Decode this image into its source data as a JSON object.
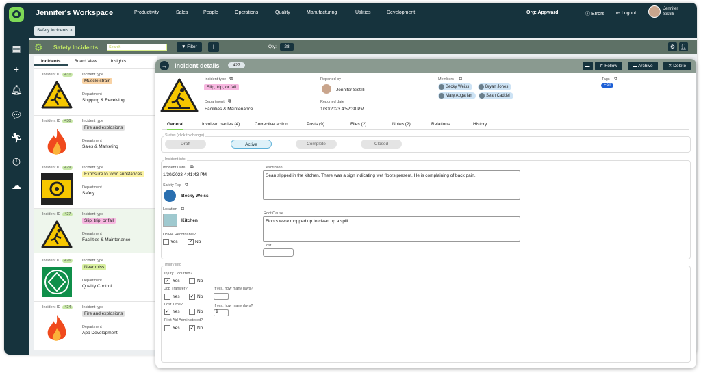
{
  "app": {
    "workspace": "Jennifer's Workspace",
    "menu": [
      "Productivity",
      "Sales",
      "People",
      "Operations",
      "Quality",
      "Manufacturing",
      "Utilities",
      "Development"
    ],
    "org_label": "Org:",
    "org_value": "Appward",
    "errors": "Errors",
    "logout": "Logout",
    "user_first": "Jennifer",
    "user_last": "Sistilli"
  },
  "tab_chip": "Safety Incidents ×",
  "module": {
    "title": "Safety Incidents",
    "search_placeholder": "Search",
    "filter": "Filter",
    "qty_label": "Qty:",
    "qty_value": "28"
  },
  "list": {
    "tabs": [
      "Incidents",
      "Board View",
      "Insights"
    ],
    "id_label": "Incident ID",
    "type_label": "Incident type",
    "dept_label": "Department",
    "items": [
      {
        "id": "431",
        "type": "Muscle strain",
        "type_color": "#f8d2a4",
        "dept": "Shipping & Receiving",
        "icon": "slip"
      },
      {
        "id": "430",
        "type": "Fire and explosions",
        "type_color": "#e0e0e0",
        "dept": "Sales & Marketing",
        "icon": "fire"
      },
      {
        "id": "429",
        "type": "Exposure to toxic substances",
        "type_color": "#fbf3a4",
        "dept": "Safety",
        "icon": "biohazard"
      },
      {
        "id": "427",
        "type": "Slip, trip, or fall",
        "type_color": "#f7b7e0",
        "dept": "Facilities & Maintenance",
        "icon": "slip"
      },
      {
        "id": "426",
        "type": "Near miss",
        "type_color": "#d8efa0",
        "dept": "Quality Control",
        "icon": "safety"
      },
      {
        "id": "424",
        "type": "Fire and explosions",
        "type_color": "#e0e0e0",
        "dept": "App Development",
        "icon": "fire"
      }
    ]
  },
  "detail": {
    "title": "Incident details",
    "number": "427",
    "follow": "Follow",
    "archive": "Archive",
    "delete": "Delete",
    "incident_type_label": "Incident type",
    "incident_type": "Slip, trip, or fall",
    "department_label": "Department",
    "department": "Facilities & Maintenance",
    "reported_by_label": "Reported by",
    "reported_by": "Jennifer Sistilli",
    "reported_date_label": "Reported date",
    "reported_date": "1/30/2023 4:52:38 PM",
    "members_label": "Members",
    "members": [
      "Becky Weiss",
      "Bryan Jones",
      "Mary Abgarian",
      "Sean Caddel"
    ],
    "tags_label": "Tags",
    "tag": "Fall",
    "tabs": [
      "General",
      "Involved parties (4)",
      "Corrective action",
      "Posts (9)",
      "Files (2)",
      "Notes (2)",
      "Relations",
      "History"
    ],
    "status_label": "Status (click to change)",
    "status_steps": [
      "Draft",
      "Active",
      "Complete",
      "Closed"
    ],
    "info_label": "Incident info",
    "date_label": "Incident Date",
    "date": "1/30/2023 4:41:43 PM",
    "rep_label": "Safety Rep",
    "rep": "Becky Weiss",
    "loc_label": "Location",
    "loc": "Kitchen",
    "osha_label": "OSHA Recordable?",
    "yes": "Yes",
    "no": "No",
    "desc_label": "Description",
    "desc": "Sean slipped in the kitchen. There was a sign indicating wet floors present. He is complaining of back pain.",
    "root_label": "Root Cause",
    "root": "Floors were mopped up to clean up a spill.",
    "cost_label": "Cost",
    "injury_label": "Injury info",
    "injury_q": "Injury Occurred?",
    "transfer_q": "Job Transfer?",
    "days_q": "If yes, how many days?",
    "lost_q": "Lost Time?",
    "firstaid_q": "First Aid Administered?",
    "dollar": "$"
  }
}
